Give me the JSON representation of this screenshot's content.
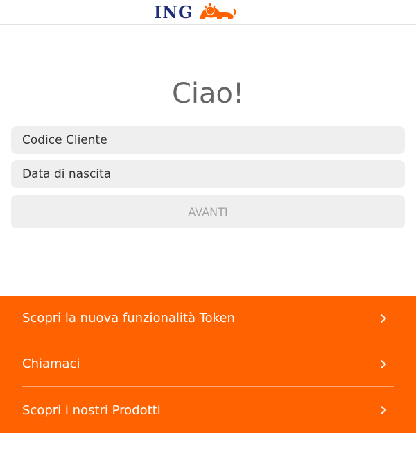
{
  "header": {
    "logo_text": "ING",
    "logo_icon": "ing-lion-icon",
    "brand_color": "#ff6200",
    "logo_text_color": "#1f2e7a"
  },
  "main": {
    "greeting": "Ciao!",
    "customer_code_placeholder": "Codice Cliente",
    "birth_date_placeholder": "Data di nascita",
    "next_button_label": "AVANTI"
  },
  "menu": {
    "items": [
      {
        "label": "Scopri la nuova funzionalità Token",
        "icon": "chevron-right-icon"
      },
      {
        "label": "Chiamaci",
        "icon": "chevron-right-icon"
      },
      {
        "label": "Scopri i nostri Prodotti",
        "icon": "chevron-right-icon"
      }
    ]
  }
}
